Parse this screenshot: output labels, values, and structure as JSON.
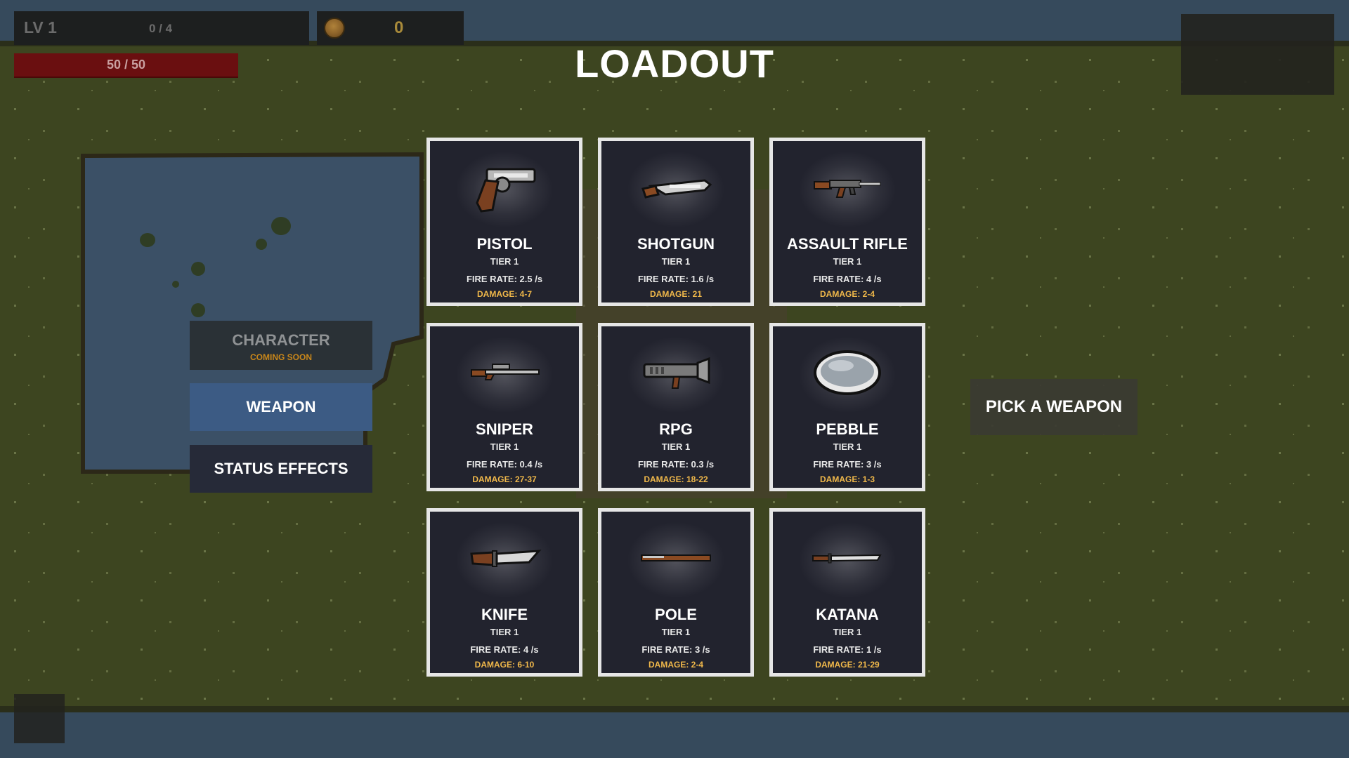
{
  "hud": {
    "level": "LV 1",
    "xp": "0 / 4",
    "coins": "0",
    "hp": "50 / 50"
  },
  "title": "LOADOUT",
  "menu": {
    "character_label": "CHARACTER",
    "character_sub": "COMING SOON",
    "weapon_label": "WEAPON",
    "status_label": "STATUS EFFECTS"
  },
  "weapons": [
    {
      "name": "PISTOL",
      "tier": "TIER 1",
      "fire_rate": "FIRE RATE: 2.5 /s",
      "damage": "DAMAGE: 4-7",
      "icon": "pistol-icon"
    },
    {
      "name": "SHOTGUN",
      "tier": "TIER 1",
      "fire_rate": "FIRE RATE: 1.6 /s",
      "damage": "DAMAGE: 21",
      "icon": "shotgun-icon"
    },
    {
      "name": "ASSAULT RIFLE",
      "tier": "TIER 1",
      "fire_rate": "FIRE RATE: 4 /s",
      "damage": "DAMAGE: 2-4",
      "icon": "assault-rifle-icon"
    },
    {
      "name": "SNIPER",
      "tier": "TIER 1",
      "fire_rate": "FIRE RATE: 0.4 /s",
      "damage": "DAMAGE: 27-37",
      "icon": "sniper-icon"
    },
    {
      "name": "RPG",
      "tier": "TIER 1",
      "fire_rate": "FIRE RATE: 0.3 /s",
      "damage": "DAMAGE: 18-22",
      "icon": "rpg-icon"
    },
    {
      "name": "PEBBLE",
      "tier": "TIER 1",
      "fire_rate": "FIRE RATE: 3 /s",
      "damage": "DAMAGE: 1-3",
      "icon": "pebble-icon"
    },
    {
      "name": "KNIFE",
      "tier": "TIER 1",
      "fire_rate": "FIRE RATE: 4 /s",
      "damage": "DAMAGE: 6-10",
      "icon": "knife-icon"
    },
    {
      "name": "POLE",
      "tier": "TIER 1",
      "fire_rate": "FIRE RATE: 3 /s",
      "damage": "DAMAGE: 2-4",
      "icon": "pole-icon"
    },
    {
      "name": "KATANA",
      "tier": "TIER 1",
      "fire_rate": "FIRE RATE: 1 /s",
      "damage": "DAMAGE: 21-29",
      "icon": "katana-icon"
    }
  ],
  "detail": {
    "prompt": "PICK A WEAPON"
  },
  "colors": {
    "grass": "#3d4520",
    "water": "#3a4f63",
    "card_bg": "#22232e",
    "card_border": "#e6e6e6",
    "damage_text": "#f0b84a",
    "weapon_button": "#3c5b84",
    "hp_bar": "#6a0f10"
  }
}
